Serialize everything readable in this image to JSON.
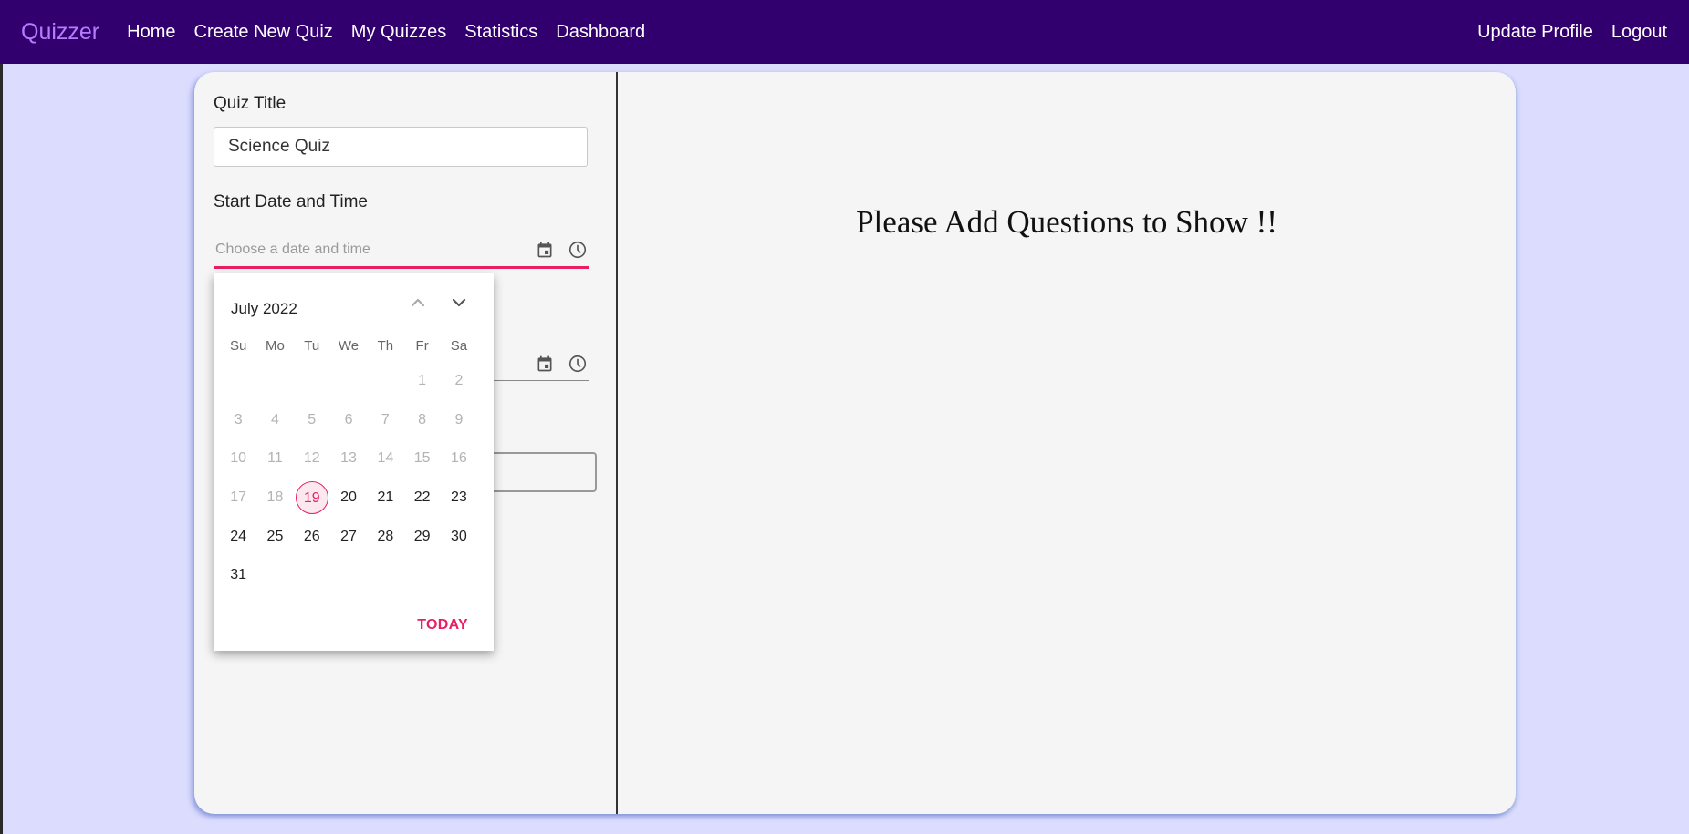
{
  "nav": {
    "brand": "Quizzer",
    "links": [
      "Home",
      "Create New Quiz",
      "My Quizzes",
      "Statistics",
      "Dashboard"
    ],
    "right_links": [
      "Update Profile",
      "Logout"
    ]
  },
  "form": {
    "quiz_title_label": "Quiz Title",
    "quiz_title_value": "Science Quiz",
    "start_label": "Start Date and Time",
    "start_placeholder": "Choose a date and time"
  },
  "main": {
    "message": "Please Add Questions to Show !!"
  },
  "datepicker": {
    "month_label": "July 2022",
    "weekdays": [
      "Su",
      "Mo",
      "Tu",
      "We",
      "Th",
      "Fr",
      "Sa"
    ],
    "weeks": [
      [
        "",
        "",
        "",
        "",
        "",
        "1",
        "2"
      ],
      [
        "3",
        "4",
        "5",
        "6",
        "7",
        "8",
        "9"
      ],
      [
        "10",
        "11",
        "12",
        "13",
        "14",
        "15",
        "16"
      ],
      [
        "17",
        "18",
        "19",
        "20",
        "21",
        "22",
        "23"
      ],
      [
        "24",
        "25",
        "26",
        "27",
        "28",
        "29",
        "30"
      ],
      [
        "31",
        "",
        "",
        "",
        "",
        "",
        ""
      ]
    ],
    "today_day": "19",
    "today_button": "TODAY"
  },
  "colors": {
    "navbar": "#32006e",
    "brand": "#b57cff",
    "accent": "#e91e63",
    "page_background": "#dcdcfe"
  },
  "icons": {
    "calendar": "calendar-icon",
    "clock": "clock-icon",
    "prev": "chevron-up-icon",
    "next": "chevron-down-icon"
  }
}
